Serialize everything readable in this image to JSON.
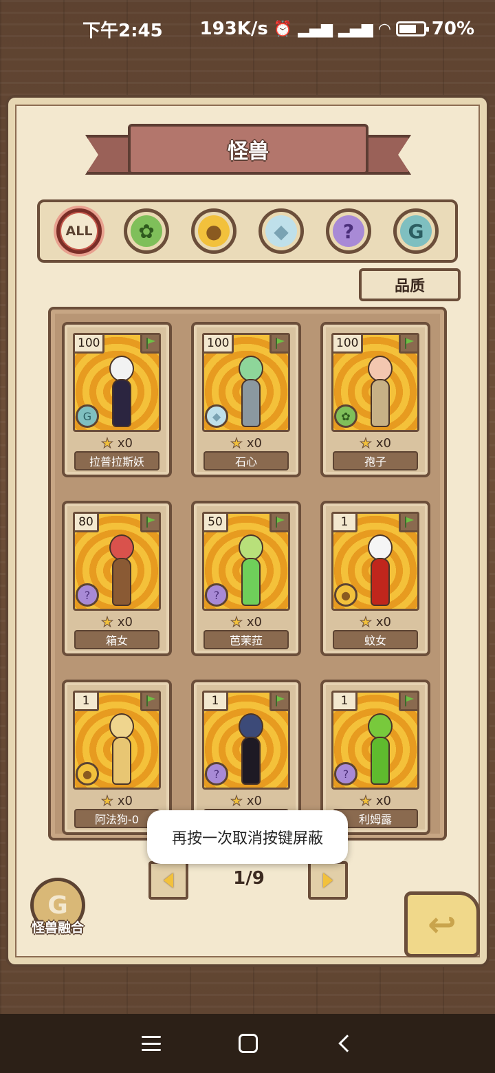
{
  "status_bar": {
    "time": "下午2:45",
    "net_speed": "193K/s",
    "battery": "70%",
    "battery_level": 0.7
  },
  "screen_title": "怪兽",
  "filters": [
    {
      "id": "all",
      "label": "ALL",
      "icon": "all-badge",
      "active": true
    },
    {
      "id": "plant",
      "icon": "leaf-icon",
      "active": false
    },
    {
      "id": "beast",
      "icon": "paw-icon",
      "active": false
    },
    {
      "id": "mineral",
      "icon": "crystal-icon",
      "active": false
    },
    {
      "id": "unknown",
      "icon": "question-icon",
      "active": false
    },
    {
      "id": "special",
      "icon": "spiral-icon",
      "active": false
    }
  ],
  "quality_button": "品质",
  "monsters": [
    {
      "count": "100",
      "qty": "x0",
      "name": "拉普拉斯妖",
      "type_icon": "spiral-icon",
      "palette": [
        "#f2f2f2",
        "#2b2540"
      ]
    },
    {
      "count": "100",
      "qty": "x0",
      "name": "石心",
      "type_icon": "crystal-icon",
      "palette": [
        "#8ed69a",
        "#8b98a0"
      ]
    },
    {
      "count": "100",
      "qty": "x0",
      "name": "孢子",
      "type_icon": "leaf-icon",
      "palette": [
        "#f3c7b0",
        "#c7b186"
      ]
    },
    {
      "count": "80",
      "qty": "x0",
      "name": "箱女",
      "type_icon": "question-icon",
      "palette": [
        "#d9524c",
        "#8a5a34"
      ]
    },
    {
      "count": "50",
      "qty": "x0",
      "name": "芭茉菈",
      "type_icon": "question-icon",
      "palette": [
        "#b8e07a",
        "#6fcf5a"
      ]
    },
    {
      "count": "1",
      "qty": "x0",
      "name": "蚊女",
      "type_icon": "paw-icon",
      "palette": [
        "#f5f5f5",
        "#c0261c"
      ]
    },
    {
      "count": "1",
      "qty": "x0",
      "name": "阿法狗-0",
      "type_icon": "paw-icon",
      "palette": [
        "#efd58e",
        "#e8c673"
      ]
    },
    {
      "count": "1",
      "qty": "x0",
      "name": "",
      "type_icon": "question-icon",
      "palette": [
        "#3c4a78",
        "#1e1a24"
      ]
    },
    {
      "count": "1",
      "qty": "x0",
      "name": "利姆露",
      "type_icon": "question-icon",
      "palette": [
        "#78c93c",
        "#5fbb2e"
      ]
    }
  ],
  "pagination": {
    "label": "1/9",
    "current": 1,
    "total": 9
  },
  "toast": "再按一次取消按键屏蔽",
  "fusion_button": "怪兽融合",
  "colors": {
    "accent": "#c3564a",
    "gold": "#f2c13c",
    "parchment": "#f3e8cf",
    "brown": "#6b4e3a"
  }
}
